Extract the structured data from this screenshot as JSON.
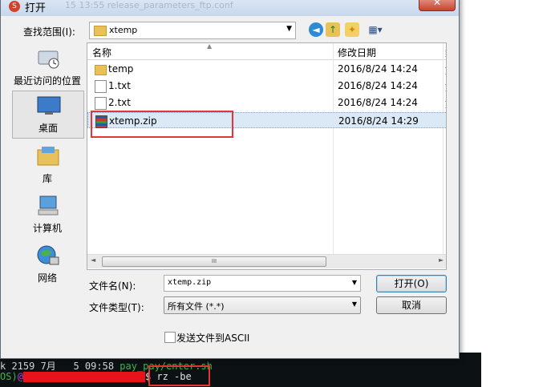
{
  "dialog": {
    "title": "打开",
    "background_title": "15 13:55 release_parameters_ftp.conf",
    "close_label": "✕",
    "look_in_label": "查找范围(I):",
    "look_in_value": "xtemp",
    "toolbar_icons": [
      "back-icon",
      "up-folder-icon",
      "new-folder-icon",
      "views-icon"
    ]
  },
  "places": [
    {
      "label": "最近访问的位置",
      "icon": "recent-places-icon"
    },
    {
      "label": "桌面",
      "icon": "desktop-icon"
    },
    {
      "label": "库",
      "icon": "libraries-icon"
    },
    {
      "label": "计算机",
      "icon": "computer-icon"
    },
    {
      "label": "网络",
      "icon": "network-icon"
    }
  ],
  "file_list": {
    "columns": [
      "名称",
      "修改日期"
    ],
    "rows": [
      {
        "name": "temp",
        "date": "2016/8/24 14:24",
        "more": "文",
        "type": "folder"
      },
      {
        "name": "1.txt",
        "date": "2016/8/24 14:24",
        "more": "文",
        "type": "text"
      },
      {
        "name": "2.txt",
        "date": "2016/8/24 14:24",
        "more": "文",
        "type": "text"
      },
      {
        "name": "xtemp.zip",
        "date": "2016/8/24 14:29",
        "more": "W",
        "type": "zip",
        "selected": true
      }
    ],
    "scroll_thumb_grip": "III"
  },
  "form": {
    "filename_label": "文件名(N):",
    "filename_value": "xtemp.zip",
    "filetype_label": "文件类型(T):",
    "filetype_value": "所有文件 (*.*)",
    "open_label": "打开(O)",
    "cancel_label": "取消",
    "ascii_label": "发送文件到ASCII",
    "ascii_checked": false
  },
  "terminal": {
    "line1_prefix": "k 2159 7月   5 09:58 ",
    "line1_file": "pay_pay/enter.sh",
    "line2_prefix": "OS)",
    "line2_at": "@",
    "line2_cmd": "$ rz -be"
  },
  "colors": {
    "highlight_box": "#e53535",
    "selection": "#dbe9f7",
    "terminal_green": "#3bb54a"
  }
}
